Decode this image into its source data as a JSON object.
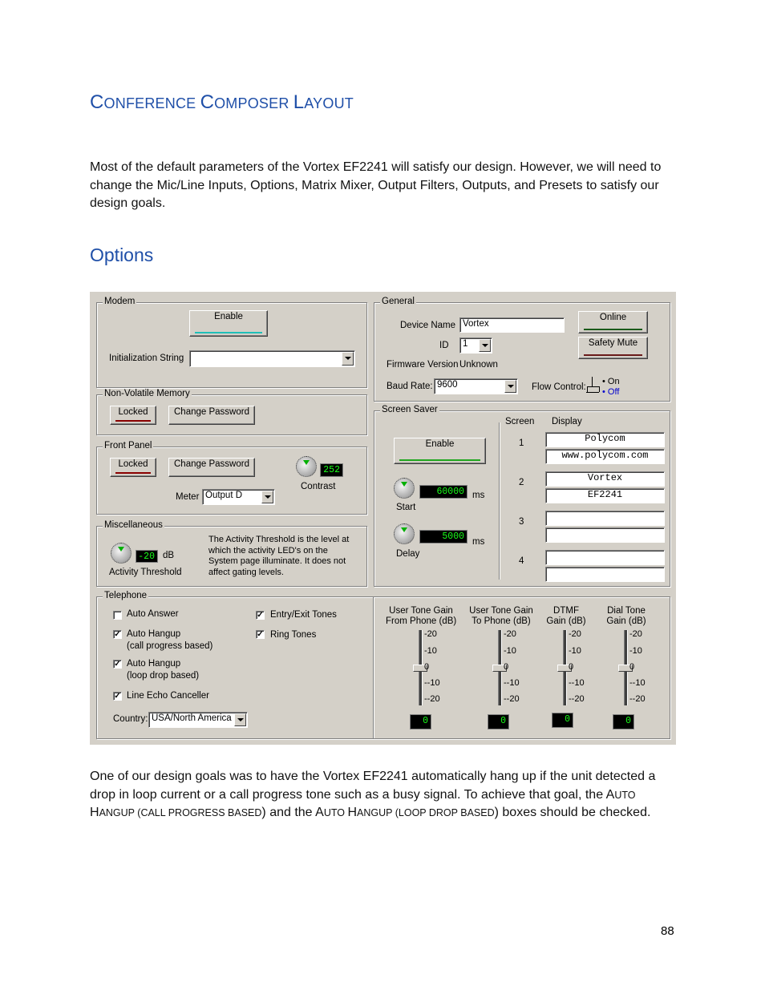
{
  "heading": {
    "first_c": "C",
    "onference": "ONFERENCE ",
    "c2": "C",
    "omposer": "OMPOSER ",
    "l": "L",
    "ayout": "AYOUT"
  },
  "intro": "Most of the default parameters of the Vortex EF2241 will satisfy our design.  However, we will need to change the Mic/Line Inputs, Options, Matrix Mixer, Output Filters, Outputs, and Presets to satisfy our design goals.",
  "section_title": "Options",
  "dialog": {
    "modem": {
      "title": "Modem",
      "enable": "Enable",
      "init_label": "Initialization String",
      "init_value": ""
    },
    "nvm": {
      "title": "Non-Volatile Memory",
      "locked": "Locked",
      "change_password": "Change Password"
    },
    "front_panel": {
      "title": "Front Panel",
      "locked": "Locked",
      "change_password": "Change Password",
      "contrast_value": "252",
      "contrast_label": "Contrast",
      "meter_label": "Meter",
      "meter_value": "Output D"
    },
    "misc": {
      "title": "Miscellaneous",
      "threshold_value": "-20",
      "db": "dB",
      "threshold_label": "Activity Threshold",
      "note": "The Activity Threshold is the level at which the activity LED's on the System page illuminate. It does not affect gating levels."
    },
    "general": {
      "title": "General",
      "device_name_label": "Device Name",
      "device_name": "Vortex",
      "id_label": "ID",
      "id_value": "1",
      "firmware_label": "Firmware Version",
      "firmware_value": "Unknown",
      "baud_label": "Baud Rate:",
      "baud_value": "9600",
      "flow_label": "Flow Control:",
      "on": "On",
      "off": "Off",
      "online": "Online",
      "safety_mute": "Safety Mute"
    },
    "screen_saver": {
      "title": "Screen Saver",
      "enable": "Enable",
      "start_value": "60000",
      "start_label": "Start",
      "delay_value": "5000",
      "delay_label": "Delay",
      "ms": "ms",
      "screen_header": "Screen",
      "display_header": "Display",
      "screens": [
        {
          "num": "1",
          "line1": "Polycom",
          "line2": "www.polycom.com"
        },
        {
          "num": "2",
          "line1": "Vortex",
          "line2": "EF2241"
        },
        {
          "num": "3",
          "line1": "",
          "line2": ""
        },
        {
          "num": "4",
          "line1": "",
          "line2": ""
        }
      ]
    },
    "telephone": {
      "title": "Telephone",
      "auto_answer": "Auto Answer",
      "auto_hangup": "Auto Hangup",
      "call_progress": "(call progress based)",
      "loop_drop": "(loop drop based)",
      "line_echo": "Line Echo Canceller",
      "entry_exit": "Entry/Exit Tones",
      "ring_tones": "Ring Tones",
      "country_label": "Country:",
      "country_value": "USA/North America",
      "check": "✓",
      "sliders": [
        {
          "l1": "User Tone Gain",
          "l2": "From Phone (dB)",
          "value": "0"
        },
        {
          "l1": "User Tone Gain",
          "l2": "To Phone (dB)",
          "value": "0"
        },
        {
          "l1": "DTMF",
          "l2": "Gain (dB)",
          "value": "0"
        },
        {
          "l1": "Dial Tone",
          "l2": "Gain (dB)",
          "value": "0"
        }
      ],
      "ticks": [
        "20",
        "10",
        "0",
        "-10",
        "-20"
      ]
    }
  },
  "closing": {
    "a": "One of our design goals was to have the Vortex EF2241 automatically hang up if the unit detected a drop in loop current or a call progress tone such as a busy signal.  To achieve that goal, the A",
    "b": "UTO ",
    "c": "H",
    "d": "ANGUP (",
    "e": "CALL PROGRESS BASED",
    "f": ") and the A",
    "g": "UTO ",
    "h": "H",
    "i": "ANGUP (",
    "j": "LOOP DROP BASED",
    "k": ") boxes should be checked."
  },
  "page_number": "88",
  "colors": {
    "heading": "#1f4fa8",
    "dialog_bg": "#d4d0c8",
    "lcd_text": "#19ff19"
  }
}
